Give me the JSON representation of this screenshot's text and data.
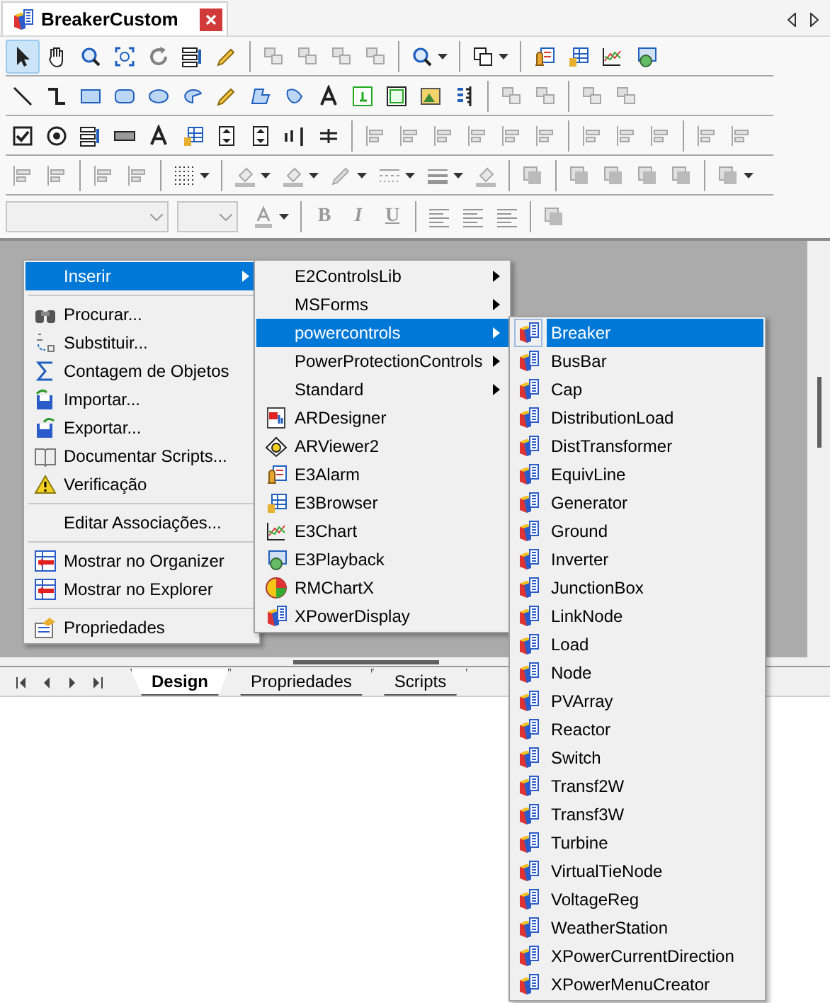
{
  "document_tab": {
    "title": "BreakerCustom",
    "selected": true
  },
  "toolbar": {
    "rows": [
      [
        {
          "kind": "button",
          "selected": true,
          "disabled": false
        },
        {
          "kind": "button",
          "selected": false,
          "disabled": false
        },
        {
          "kind": "button",
          "selected": false,
          "disabled": false
        },
        {
          "kind": "button",
          "selected": false,
          "disabled": false
        },
        {
          "kind": "button",
          "selected": false,
          "disabled": true
        },
        {
          "kind": "button",
          "selected": false,
          "disabled": false
        },
        {
          "kind": "button",
          "selected": false,
          "disabled": false
        },
        {
          "kind": "separator"
        },
        {
          "kind": "button",
          "selected": false,
          "disabled": true
        },
        {
          "kind": "button",
          "selected": false,
          "disabled": true
        },
        {
          "kind": "button",
          "selected": false,
          "disabled": true
        },
        {
          "kind": "button",
          "selected": false,
          "disabled": true
        },
        {
          "kind": "separator"
        },
        {
          "kind": "dropdown",
          "selected": false,
          "disabled": false
        },
        {
          "kind": "separator"
        },
        {
          "kind": "dropdown",
          "selected": false,
          "disabled": false
        },
        {
          "kind": "separator"
        },
        {
          "kind": "button",
          "selected": false,
          "disabled": false
        },
        {
          "kind": "button",
          "selected": false,
          "disabled": false
        },
        {
          "kind": "button",
          "selected": false,
          "disabled": false
        },
        {
          "kind": "button",
          "selected": false,
          "disabled": false
        }
      ],
      [
        {
          "kind": "button",
          "selected": false,
          "disabled": false
        },
        {
          "kind": "button",
          "selected": false,
          "disabled": false
        },
        {
          "kind": "button",
          "selected": false,
          "disabled": false
        },
        {
          "kind": "button",
          "selected": false,
          "disabled": false
        },
        {
          "kind": "button",
          "selected": false,
          "disabled": false
        },
        {
          "kind": "button",
          "selected": false,
          "disabled": false
        },
        {
          "kind": "button",
          "selected": false,
          "disabled": false
        },
        {
          "kind": "button",
          "selected": false,
          "disabled": false
        },
        {
          "kind": "button",
          "selected": false,
          "disabled": false
        },
        {
          "kind": "button",
          "selected": false,
          "disabled": false
        },
        {
          "kind": "button",
          "selected": false,
          "disabled": false
        },
        {
          "kind": "button",
          "selected": false,
          "disabled": false
        },
        {
          "kind": "button",
          "selected": false,
          "disabled": false
        },
        {
          "kind": "button",
          "selected": false,
          "disabled": false
        },
        {
          "kind": "separator"
        },
        {
          "kind": "button",
          "selected": false,
          "disabled": true
        },
        {
          "kind": "button",
          "selected": false,
          "disabled": true
        },
        {
          "kind": "separator"
        },
        {
          "kind": "button",
          "selected": false,
          "disabled": true
        },
        {
          "kind": "button",
          "selected": false,
          "disabled": true
        }
      ],
      [
        {
          "kind": "button",
          "selected": false,
          "disabled": false
        },
        {
          "kind": "button",
          "selected": false,
          "disabled": false
        },
        {
          "kind": "button",
          "selected": false,
          "disabled": false
        },
        {
          "kind": "button",
          "selected": false,
          "disabled": false
        },
        {
          "kind": "button",
          "selected": false,
          "disabled": false
        },
        {
          "kind": "button",
          "selected": false,
          "disabled": false
        },
        {
          "kind": "button",
          "selected": false,
          "disabled": false
        },
        {
          "kind": "button",
          "selected": false,
          "disabled": false
        },
        {
          "kind": "button",
          "selected": false,
          "disabled": false
        },
        {
          "kind": "button",
          "selected": false,
          "disabled": false
        },
        {
          "kind": "separator"
        },
        {
          "kind": "button",
          "selected": false,
          "disabled": true
        },
        {
          "kind": "button",
          "selected": false,
          "disabled": true
        },
        {
          "kind": "button",
          "selected": false,
          "disabled": true
        },
        {
          "kind": "button",
          "selected": false,
          "disabled": true
        },
        {
          "kind": "button",
          "selected": false,
          "disabled": true
        },
        {
          "kind": "button",
          "selected": false,
          "disabled": true
        },
        {
          "kind": "separator"
        },
        {
          "kind": "button",
          "selected": false,
          "disabled": true
        },
        {
          "kind": "button",
          "selected": false,
          "disabled": true
        },
        {
          "kind": "button",
          "selected": false,
          "disabled": true
        },
        {
          "kind": "separator"
        },
        {
          "kind": "button",
          "selected": false,
          "disabled": true
        },
        {
          "kind": "button",
          "selected": false,
          "disabled": true
        }
      ],
      [
        {
          "kind": "button",
          "selected": false,
          "disabled": true
        },
        {
          "kind": "button",
          "selected": false,
          "disabled": true
        },
        {
          "kind": "separator"
        },
        {
          "kind": "button",
          "selected": false,
          "disabled": true
        },
        {
          "kind": "button",
          "selected": false,
          "disabled": true
        },
        {
          "kind": "separator"
        },
        {
          "kind": "dropdown",
          "selected": false,
          "disabled": false
        },
        {
          "kind": "separator"
        },
        {
          "kind": "dropdown",
          "selected": false,
          "disabled": true
        },
        {
          "kind": "dropdown",
          "selected": false,
          "disabled": true
        },
        {
          "kind": "dropdown",
          "selected": false,
          "disabled": true
        },
        {
          "kind": "dropdown",
          "selected": false,
          "disabled": true
        },
        {
          "kind": "dropdown",
          "selected": false,
          "disabled": true
        },
        {
          "kind": "button",
          "selected": false,
          "disabled": true
        },
        {
          "kind": "separator"
        },
        {
          "kind": "button",
          "selected": false,
          "disabled": true
        },
        {
          "kind": "separator"
        },
        {
          "kind": "button",
          "selected": false,
          "disabled": true
        },
        {
          "kind": "button",
          "selected": false,
          "disabled": true
        },
        {
          "kind": "button",
          "selected": false,
          "disabled": true
        },
        {
          "kind": "button",
          "selected": false,
          "disabled": true
        },
        {
          "kind": "separator"
        },
        {
          "kind": "dropdown",
          "selected": false,
          "disabled": true
        }
      ],
      [
        {
          "kind": "combo",
          "disabled": true
        },
        {
          "kind": "combo",
          "disabled": true
        },
        {
          "kind": "dropdown",
          "selected": false,
          "disabled": true
        },
        {
          "kind": "separator"
        },
        {
          "kind": "button",
          "selected": false,
          "disabled": true,
          "label": "B"
        },
        {
          "kind": "button",
          "selected": false,
          "disabled": true,
          "label": "I"
        },
        {
          "kind": "button",
          "selected": false,
          "disabled": true,
          "label": "U"
        },
        {
          "kind": "separator"
        },
        {
          "kind": "button",
          "selected": false,
          "disabled": true
        },
        {
          "kind": "button",
          "selected": false,
          "disabled": true
        },
        {
          "kind": "button",
          "selected": false,
          "disabled": true
        },
        {
          "kind": "separator"
        },
        {
          "kind": "button",
          "selected": false,
          "disabled": true
        }
      ]
    ]
  },
  "context_menu": {
    "items": [
      {
        "kind": "item",
        "label": "Inserir",
        "selected": true,
        "submenu": true
      },
      {
        "kind": "separator"
      },
      {
        "kind": "item",
        "label": "Procurar...",
        "selected": false,
        "submenu": false
      },
      {
        "kind": "item",
        "label": "Substituir...",
        "selected": false,
        "submenu": false
      },
      {
        "kind": "item",
        "label": "Contagem de Objetos",
        "selected": false,
        "submenu": false
      },
      {
        "kind": "item",
        "label": "Importar...",
        "selected": false,
        "submenu": false
      },
      {
        "kind": "item",
        "label": "Exportar...",
        "selected": false,
        "submenu": false
      },
      {
        "kind": "item",
        "label": "Documentar Scripts...",
        "selected": false,
        "submenu": false
      },
      {
        "kind": "item",
        "label": "Verificação",
        "selected": false,
        "submenu": false
      },
      {
        "kind": "separator"
      },
      {
        "kind": "item",
        "label": "Editar Associações...",
        "selected": false,
        "submenu": false
      },
      {
        "kind": "separator"
      },
      {
        "kind": "item",
        "label": "Mostrar no Organizer",
        "selected": false,
        "submenu": false
      },
      {
        "kind": "item",
        "label": "Mostrar no Explorer",
        "selected": false,
        "submenu": false
      },
      {
        "kind": "separator"
      },
      {
        "kind": "item",
        "label": "Propriedades",
        "selected": false,
        "submenu": false
      }
    ]
  },
  "insert_submenu": {
    "items": [
      {
        "kind": "item",
        "label": "E2ControlsLib",
        "selected": false,
        "submenu": true
      },
      {
        "kind": "item",
        "label": "MSForms",
        "selected": false,
        "submenu": true
      },
      {
        "kind": "item",
        "label": "powercontrols",
        "selected": true,
        "submenu": true
      },
      {
        "kind": "item",
        "label": "PowerProtectionControls",
        "selected": false,
        "submenu": true
      },
      {
        "kind": "item",
        "label": "Standard",
        "selected": false,
        "submenu": true
      },
      {
        "kind": "item",
        "label": "ARDesigner",
        "selected": false,
        "submenu": false
      },
      {
        "kind": "item",
        "label": "ARViewer2",
        "selected": false,
        "submenu": false
      },
      {
        "kind": "item",
        "label": "E3Alarm",
        "selected": false,
        "submenu": false
      },
      {
        "kind": "item",
        "label": "E3Browser",
        "selected": false,
        "submenu": false
      },
      {
        "kind": "item",
        "label": "E3Chart",
        "selected": false,
        "submenu": false
      },
      {
        "kind": "item",
        "label": "E3Playback",
        "selected": false,
        "submenu": false
      },
      {
        "kind": "item",
        "label": "RMChartX",
        "selected": false,
        "submenu": false
      },
      {
        "kind": "item",
        "label": "XPowerDisplay",
        "selected": false,
        "submenu": false
      }
    ]
  },
  "powercontrols_submenu": {
    "items": [
      {
        "label": "Breaker",
        "selected": true
      },
      {
        "label": "BusBar",
        "selected": false
      },
      {
        "label": "Cap",
        "selected": false
      },
      {
        "label": "DistributionLoad",
        "selected": false
      },
      {
        "label": "DistTransformer",
        "selected": false
      },
      {
        "label": "EquivLine",
        "selected": false
      },
      {
        "label": "Generator",
        "selected": false
      },
      {
        "label": "Ground",
        "selected": false
      },
      {
        "label": "Inverter",
        "selected": false
      },
      {
        "label": "JunctionBox",
        "selected": false
      },
      {
        "label": "LinkNode",
        "selected": false
      },
      {
        "label": "Load",
        "selected": false
      },
      {
        "label": "Node",
        "selected": false
      },
      {
        "label": "PVArray",
        "selected": false
      },
      {
        "label": "Reactor",
        "selected": false
      },
      {
        "label": "Switch",
        "selected": false
      },
      {
        "label": "Transf2W",
        "selected": false
      },
      {
        "label": "Transf3W",
        "selected": false
      },
      {
        "label": "Turbine",
        "selected": false
      },
      {
        "label": "VirtualTieNode",
        "selected": false
      },
      {
        "label": "VoltageReg",
        "selected": false
      },
      {
        "label": "WeatherStation",
        "selected": false
      },
      {
        "label": "XPowerCurrentDirection",
        "selected": false
      },
      {
        "label": "XPowerMenuCreator",
        "selected": false
      }
    ]
  },
  "bottom_tabs": [
    {
      "label": "Design",
      "selected": true
    },
    {
      "label": "Propriedades",
      "selected": false
    },
    {
      "label": "Scripts",
      "selected": false
    }
  ]
}
